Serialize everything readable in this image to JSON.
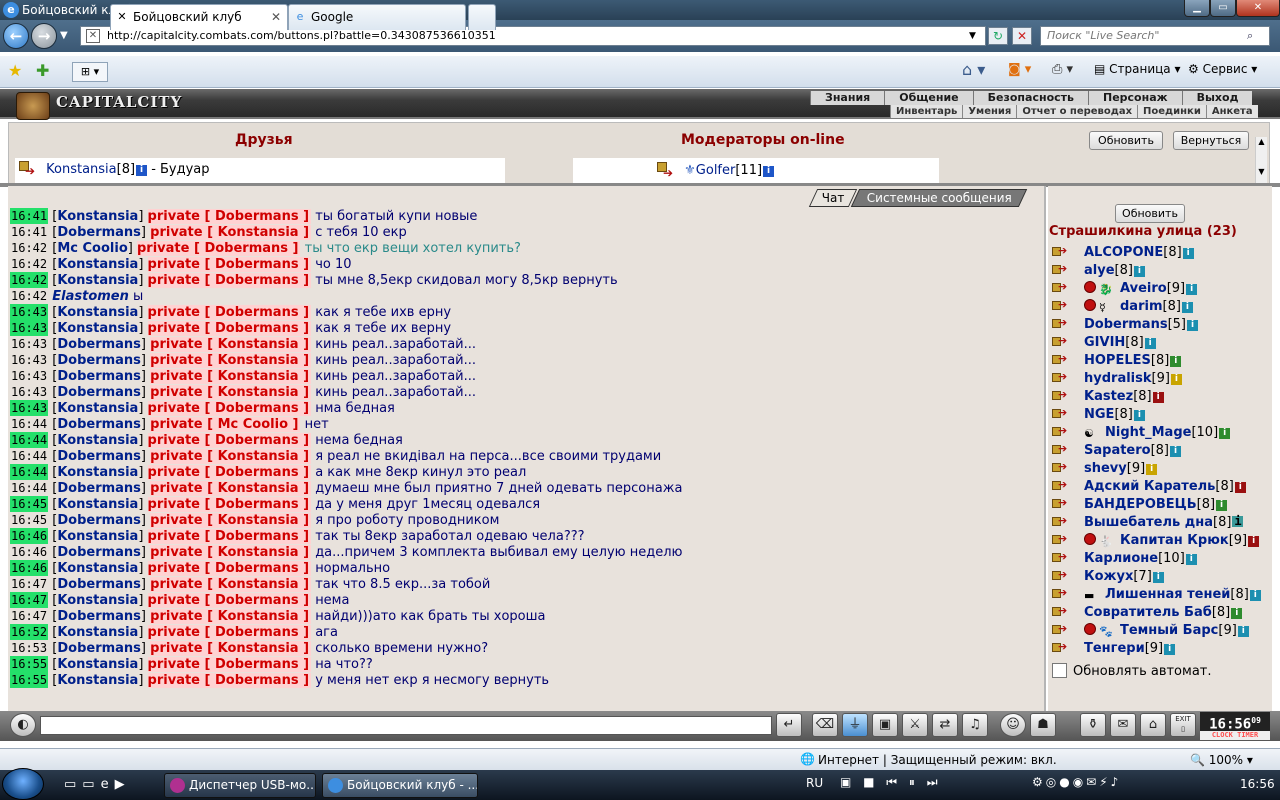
{
  "window": {
    "title": "Бойцовский клуб - Windows Internet Explorer"
  },
  "browser": {
    "url": "http://capitalcity.combats.com/buttons.pl?battle=0.343087536610351",
    "search_placeholder": "Поиск \"Live Search\"",
    "tabs": [
      {
        "label": "Бойцовский клуб"
      },
      {
        "label": "Google"
      }
    ],
    "toolbar": {
      "page_label": "Страница",
      "tools_label": "Сервис"
    },
    "status": "Интернет | Защищенный режим: вкл.",
    "zoom": "100%"
  },
  "game": {
    "logo": "CAPITALCITY",
    "menu_top": [
      "Знания",
      "Общение",
      "Безопасность",
      "Персонаж",
      "Выход"
    ],
    "menu_bottom": [
      "Инвентарь",
      "Умения",
      "Отчет о переводах",
      "Поединки",
      "Анкета"
    ],
    "friends_title": "Друзья",
    "moderators_title": "Модераторы on-line",
    "refresh_button": "Обновить",
    "return_button": "Вернуться",
    "friend": {
      "name": "Konstansia",
      "level": "[8]",
      "location": " - Будуар"
    },
    "moderator": {
      "name": "Golfer",
      "level": "[11]"
    },
    "chat_tab": "Чат",
    "system_tab": "Системные сообщения",
    "right_refresh": "Обновить",
    "location": "Страшилкина улица (23)",
    "auto_refresh_label": "Обновлять автомат.",
    "clock": {
      "time": "16:56",
      "seconds": "09",
      "label": "CLOCK  TIMER"
    }
  },
  "messages": [
    {
      "time": "16:41",
      "hl": true,
      "from": "Konstansia",
      "to": "Dobermans",
      "text": "ты богатый купи новые"
    },
    {
      "time": "16:41",
      "hl": false,
      "from": "Dobermans",
      "to": "Konstansia",
      "text": "с тебя 10 екр"
    },
    {
      "time": "16:42",
      "hl": false,
      "from": "Mc Coolio",
      "to": "Dobermans",
      "text": "ты что екр вещи хотел купить?",
      "teal": true
    },
    {
      "time": "16:42",
      "hl": false,
      "from": "Konstansia",
      "to": "Dobermans",
      "text": "чо 10"
    },
    {
      "time": "16:42",
      "hl": true,
      "from": "Konstansia",
      "to": "Dobermans",
      "text": "ты мне 8,5екр скидовал могу 8,5кр вернуть"
    },
    {
      "time": "16:42",
      "hl": false,
      "emote": "Elastomen",
      "text": "ы"
    },
    {
      "time": "16:43",
      "hl": true,
      "from": "Konstansia",
      "to": "Dobermans",
      "text": "как я тебе ихв ерну"
    },
    {
      "time": "16:43",
      "hl": true,
      "from": "Konstansia",
      "to": "Dobermans",
      "text": "как я тебе их верну"
    },
    {
      "time": "16:43",
      "hl": false,
      "from": "Dobermans",
      "to": "Konstansia",
      "text": "кинь реал..заработай..."
    },
    {
      "time": "16:43",
      "hl": false,
      "from": "Dobermans",
      "to": "Konstansia",
      "text": "кинь реал..заработай..."
    },
    {
      "time": "16:43",
      "hl": false,
      "from": "Dobermans",
      "to": "Konstansia",
      "text": "кинь реал..заработай..."
    },
    {
      "time": "16:43",
      "hl": false,
      "from": "Dobermans",
      "to": "Konstansia",
      "text": "кинь реал..заработай..."
    },
    {
      "time": "16:43",
      "hl": true,
      "from": "Konstansia",
      "to": "Dobermans",
      "text": "нма бедная"
    },
    {
      "time": "16:44",
      "hl": false,
      "from": "Dobermans",
      "to": "Mc Coolio",
      "text": "нет"
    },
    {
      "time": "16:44",
      "hl": true,
      "from": "Konstansia",
      "to": "Dobermans",
      "text": "нема бедная"
    },
    {
      "time": "16:44",
      "hl": false,
      "from": "Dobermans",
      "to": "Konstansia",
      "text": "я реал не вкидівал на перса...все своими трудами"
    },
    {
      "time": "16:44",
      "hl": true,
      "from": "Konstansia",
      "to": "Dobermans",
      "text": "а как мне 8екр кинул это реал"
    },
    {
      "time": "16:44",
      "hl": false,
      "from": "Dobermans",
      "to": "Konstansia",
      "text": "думаеш мне был приятно 7 дней одевать персонажа"
    },
    {
      "time": "16:45",
      "hl": true,
      "from": "Konstansia",
      "to": "Dobermans",
      "text": "да у меня друг 1месяц одевался"
    },
    {
      "time": "16:45",
      "hl": false,
      "from": "Dobermans",
      "to": "Konstansia",
      "text": "я про роботу проводником"
    },
    {
      "time": "16:46",
      "hl": true,
      "from": "Konstansia",
      "to": "Dobermans",
      "text": "так ты 8екр заработал одеваю чела???"
    },
    {
      "time": "16:46",
      "hl": false,
      "from": "Dobermans",
      "to": "Konstansia",
      "text": "да...причем 3 комплекта выбивал ему целую неделю"
    },
    {
      "time": "16:46",
      "hl": true,
      "from": "Konstansia",
      "to": "Dobermans",
      "text": "нормально"
    },
    {
      "time": "16:47",
      "hl": false,
      "from": "Dobermans",
      "to": "Konstansia",
      "text": "так что 8.5 екр...за тобой"
    },
    {
      "time": "16:47",
      "hl": true,
      "from": "Konstansia",
      "to": "Dobermans",
      "text": "нема"
    },
    {
      "time": "16:47",
      "hl": false,
      "from": "Dobermans",
      "to": "Konstansia",
      "text": "найди)))ато как брать ты хороша"
    },
    {
      "time": "16:52",
      "hl": true,
      "from": "Konstansia",
      "to": "Dobermans",
      "text": "ага"
    },
    {
      "time": "16:53",
      "hl": false,
      "from": "Dobermans",
      "to": "Konstansia",
      "text": "сколько времени нужно?"
    },
    {
      "time": "16:55",
      "hl": true,
      "from": "Konstansia",
      "to": "Dobermans",
      "text": "на что??"
    },
    {
      "time": "16:55",
      "hl": true,
      "from": "Konstansia",
      "to": "Dobermans",
      "text": "у меня нет екр я несмогу вернуть"
    }
  ],
  "users": [
    {
      "name": "ALCOPONE",
      "level": "[8]",
      "info": "c"
    },
    {
      "name": "alye",
      "level": "[8]",
      "info": "c"
    },
    {
      "name": "Aveiro",
      "level": "[9]",
      "info": "c",
      "badge": true,
      "emblem": "🐉"
    },
    {
      "name": "darim",
      "level": "[8]",
      "info": "c",
      "badge": true,
      "emblem": "☿"
    },
    {
      "name": "Dobermans",
      "level": "[5]",
      "info": "c"
    },
    {
      "name": "GIVIH",
      "level": "[8]",
      "info": "c"
    },
    {
      "name": "HOPELES",
      "level": "[8]",
      "info": "g"
    },
    {
      "name": "hydralisk",
      "level": "[9]",
      "info": "y"
    },
    {
      "name": "Kastez",
      "level": "[8]",
      "info": "r"
    },
    {
      "name": "NGE",
      "level": "[8]",
      "info": "c"
    },
    {
      "name": "Night_Mage",
      "level": "[10]",
      "info": "g",
      "emblem": "☯"
    },
    {
      "name": "Sapatero",
      "level": "[8]",
      "info": "c"
    },
    {
      "name": "shevy",
      "level": "[9]",
      "info": "y"
    },
    {
      "name": "Адский Каратель",
      "level": "[8]",
      "info": "r"
    },
    {
      "name": "БАНДЕРОВЕЦЬ",
      "level": "[8]",
      "info": "g"
    },
    {
      "name": "Вышебатель дна",
      "level": "[8]",
      "info": "t"
    },
    {
      "name": "Капитан Крюк",
      "level": "[9]",
      "info": "r",
      "badge": true,
      "emblem": "🐇"
    },
    {
      "name": "Карлионе",
      "level": "[10]",
      "info": "c"
    },
    {
      "name": "Кожух",
      "level": "[7]",
      "info": "c"
    },
    {
      "name": "Лишенная теней",
      "level": "[8]",
      "info": "c",
      "emblem": "▬"
    },
    {
      "name": "Совратитель Баб",
      "level": "[8]",
      "info": "g"
    },
    {
      "name": "Темный Барс",
      "level": "[9]",
      "info": "c",
      "badge": true,
      "emblem": "🐾"
    },
    {
      "name": "Тенгери",
      "level": "[9]",
      "info": "c"
    }
  ],
  "taskbar": {
    "tasks": [
      {
        "label": "Диспетчер USB-мо..."
      },
      {
        "label": "Бойцовский клуб - ..."
      }
    ],
    "lang": "RU",
    "time": "16:56"
  }
}
